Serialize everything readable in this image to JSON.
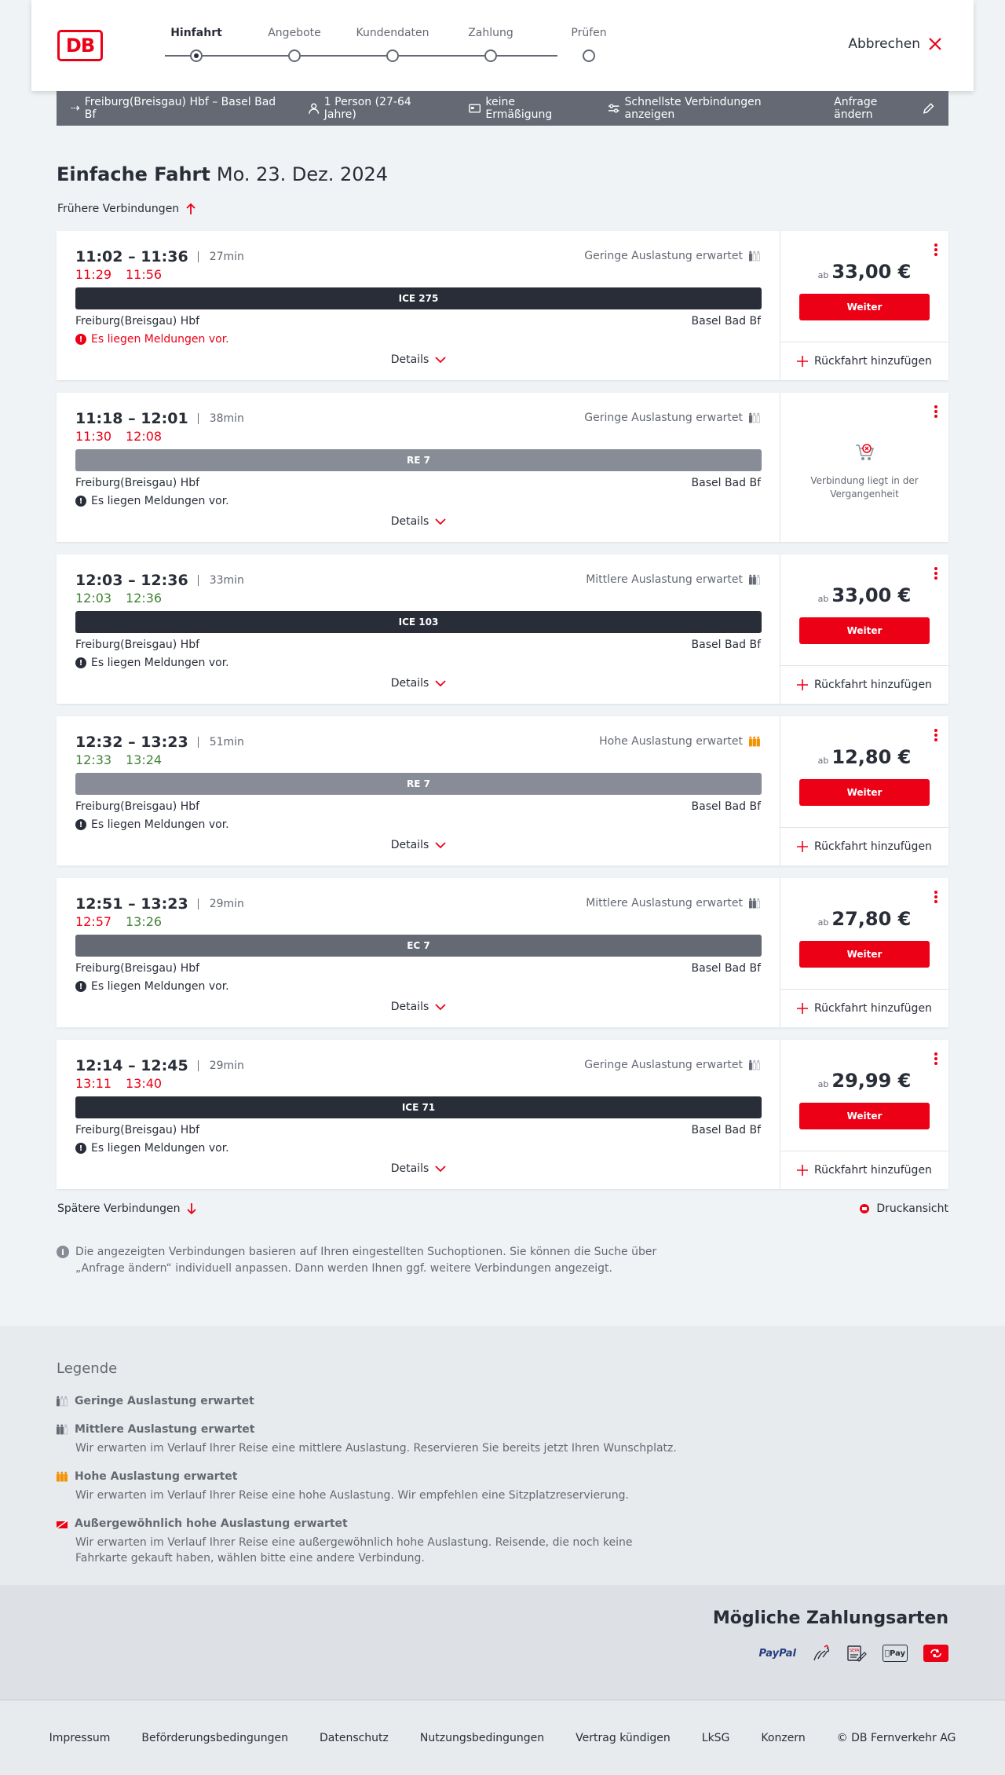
{
  "header": {
    "logo": "DB",
    "cancel": "Abbrechen",
    "steps": [
      "Hinfahrt",
      "Angebote",
      "Kundendaten",
      "Zahlung",
      "Prüfen"
    ]
  },
  "request_bar": {
    "route": "Freiburg(Breisgau) Hbf – Basel Bad Bf",
    "persons": "1 Person (27-64 Jahre)",
    "discount": "keine Ermäßigung",
    "fastest": "Schnellste Verbindungen anzeigen",
    "change": "Anfrage ändern"
  },
  "title": {
    "type": "Einfache Fahrt",
    "date": "Mo. 23. Dez. 2024"
  },
  "earlier": "Frühere Verbindungen",
  "later": "Spätere Verbindungen",
  "print": "Druckansicht",
  "labels": {
    "details": "Details",
    "weiter": "Weiter",
    "return": "Rückfahrt hinzufügen",
    "ab": "ab",
    "past": "Verbindung liegt in der Vergangenheit"
  },
  "connections": [
    {
      "times": "11:02 – 11:36",
      "dur": "27min",
      "rt1": "11:29",
      "rt2": "11:56",
      "rtc1": "r",
      "rtc2": "r",
      "occ": "Geringe Auslastung erwartet",
      "occ_level": 1,
      "train": "ICE 275",
      "train_color": "#282d37",
      "from": "Freiburg(Breisgau) Hbf",
      "to": "Basel Bad Bf",
      "msg": "Es liegen Meldungen vor.",
      "msg_red": true,
      "price": "33,00 €",
      "past": false
    },
    {
      "times": "11:18 – 12:01",
      "dur": "38min",
      "rt1": "11:30",
      "rt2": "12:08",
      "rtc1": "r",
      "rtc2": "r",
      "occ": "Geringe Auslastung erwartet",
      "occ_level": 1,
      "train": "RE 7",
      "train_color": "#878c96",
      "from": "Freiburg(Breisgau) Hbf",
      "to": "Basel Bad Bf",
      "msg": "Es liegen Meldungen vor.",
      "msg_red": false,
      "price": "",
      "past": true
    },
    {
      "times": "12:03 – 12:36",
      "dur": "33min",
      "rt1": "12:03",
      "rt2": "12:36",
      "rtc1": "g",
      "rtc2": "g",
      "occ": "Mittlere Auslastung erwartet",
      "occ_level": 2,
      "train": "ICE 103",
      "train_color": "#282d37",
      "from": "Freiburg(Breisgau) Hbf",
      "to": "Basel Bad Bf",
      "msg": "Es liegen Meldungen vor.",
      "msg_red": false,
      "price": "33,00 €",
      "past": false
    },
    {
      "times": "12:32 – 13:23",
      "dur": "51min",
      "rt1": "12:33",
      "rt2": "13:24",
      "rtc1": "g",
      "rtc2": "g",
      "occ": "Hohe Auslastung erwartet",
      "occ_level": 3,
      "train": "RE 7",
      "train_color": "#878c96",
      "from": "Freiburg(Breisgau) Hbf",
      "to": "Basel Bad Bf",
      "msg": "Es liegen Meldungen vor.",
      "msg_red": false,
      "price": "12,80 €",
      "past": false
    },
    {
      "times": "12:51 – 13:23",
      "dur": "29min",
      "rt1": "12:57",
      "rt2": "13:26",
      "rtc1": "r",
      "rtc2": "g",
      "occ": "Mittlere Auslastung erwartet",
      "occ_level": 2,
      "train": "EC 7",
      "train_color": "#646973",
      "from": "Freiburg(Breisgau) Hbf",
      "to": "Basel Bad Bf",
      "msg": "Es liegen Meldungen vor.",
      "msg_red": false,
      "price": "27,80 €",
      "past": false
    },
    {
      "times": "12:14 – 12:45",
      "dur": "29min",
      "rt1": "13:11",
      "rt2": "13:40",
      "rtc1": "r",
      "rtc2": "r",
      "occ": "Geringe Auslastung erwartet",
      "occ_level": 1,
      "train": "ICE 71",
      "train_color": "#282d37",
      "from": "Freiburg(Breisgau) Hbf",
      "to": "Basel Bad Bf",
      "msg": "Es liegen Meldungen vor.",
      "msg_red": false,
      "price": "29,99 €",
      "past": false
    }
  ],
  "info": "Die angezeigten Verbindungen basieren auf Ihren eingestellten Suchoptionen. Sie können die Suche über „Anfrage ändern“ individuell anpassen. Dann werden Ihnen ggf. weitere Verbindungen angezeigt.",
  "legend": {
    "title": "Legende",
    "items": [
      {
        "t": "Geringe Auslastung erwartet",
        "d": ""
      },
      {
        "t": "Mittlere Auslastung erwartet",
        "d": "Wir erwarten im Verlauf Ihrer Reise eine mittlere Auslastung. Reservieren Sie bereits jetzt Ihren Wunschplatz."
      },
      {
        "t": "Hohe Auslastung erwartet",
        "d": "Wir erwarten im Verlauf Ihrer Reise eine hohe Auslastung. Wir empfehlen eine Sitzplatzreservierung."
      },
      {
        "t": "Außergewöhnlich hohe Auslastung erwartet",
        "d": "Wir erwarten im Verlauf Ihrer Reise eine außergewöhnlich hohe Auslastung. Reisende, die noch keine Fahrkarte gekauft haben, wählen bitte eine andere Verbindung."
      }
    ]
  },
  "payment": {
    "title": "Mögliche Zahlungsarten",
    "paypal": "PayPal",
    "sepa": "SEPA",
    "applepay": "Pay"
  },
  "footer": [
    "Impressum",
    "Beförderungsbedingungen",
    "Datenschutz",
    "Nutzungsbedingungen",
    "Vertrag kündigen",
    "LkSG",
    "Konzern",
    "© DB Fernverkehr AG"
  ]
}
